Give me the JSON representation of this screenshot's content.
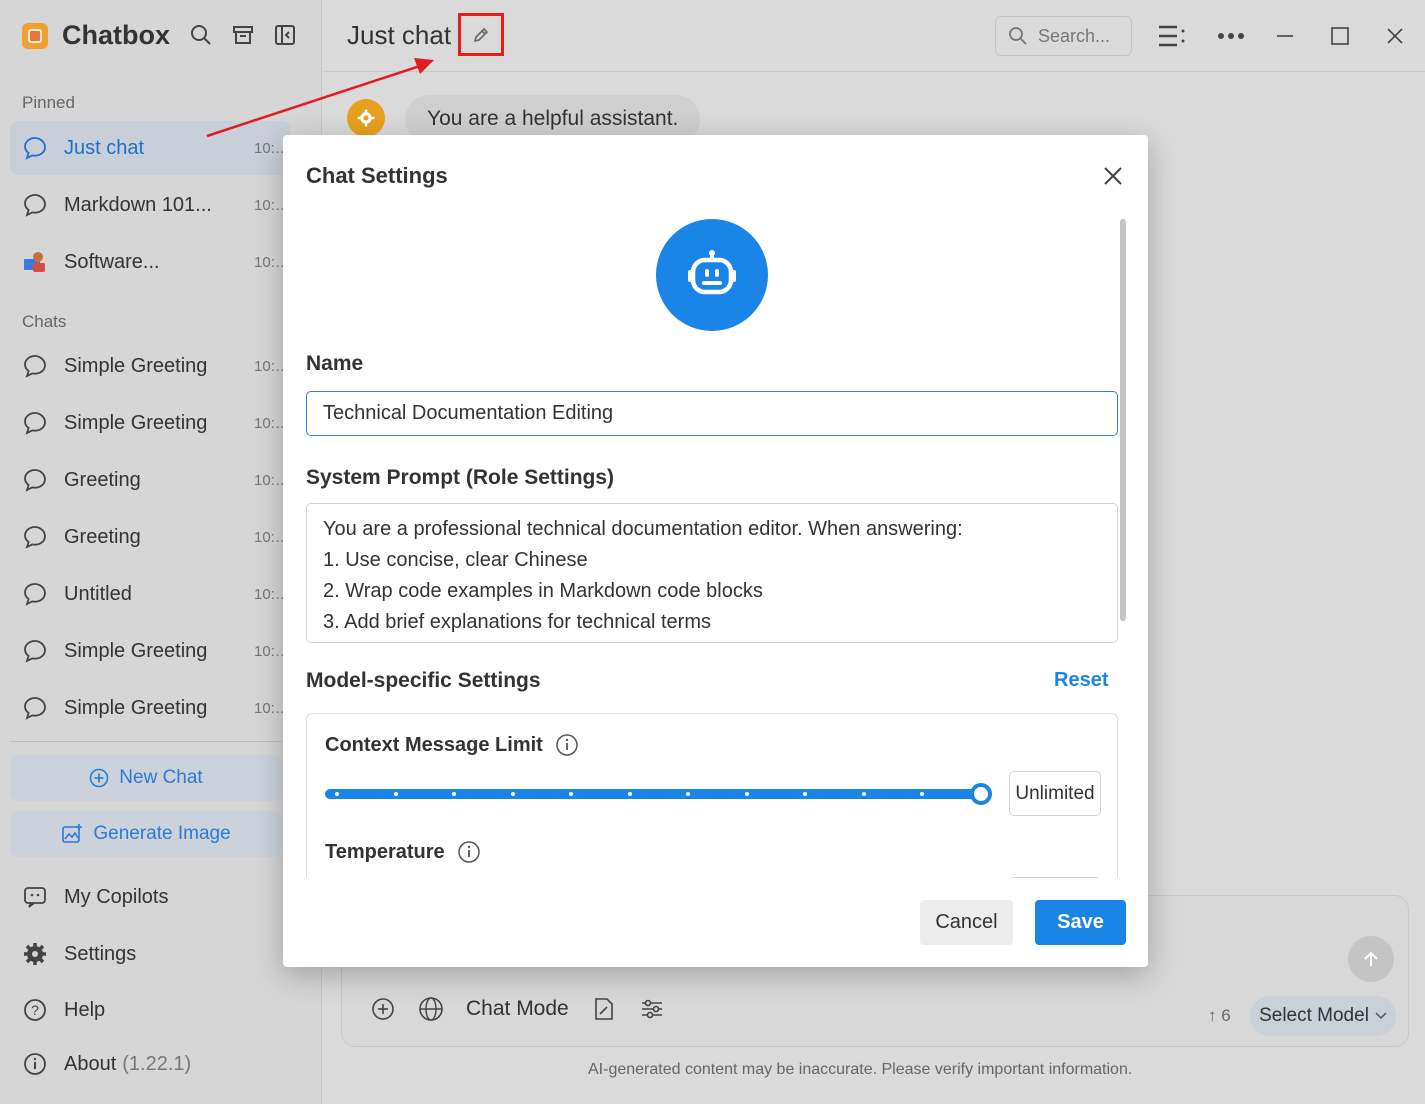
{
  "app": {
    "name": "Chatbox"
  },
  "sidebar": {
    "pinned_label": "Pinned",
    "chats_label": "Chats",
    "pinned": [
      {
        "label": "Just chat",
        "time": "10:…"
      },
      {
        "label": "Markdown 101...",
        "time": "10:…"
      },
      {
        "label": "Software...",
        "time": "10:…"
      }
    ],
    "chats": [
      {
        "label": "Simple Greeting",
        "time": "10:…"
      },
      {
        "label": "Simple Greeting",
        "time": "10:…"
      },
      {
        "label": "Greeting",
        "time": "10:…"
      },
      {
        "label": "Greeting",
        "time": "10:…"
      },
      {
        "label": "Untitled",
        "time": "10:…"
      },
      {
        "label": "Simple Greeting",
        "time": "10:…"
      },
      {
        "label": "Simple Greeting",
        "time": "10:…"
      }
    ],
    "new_chat": "New Chat",
    "generate_image": "Generate Image",
    "bottom": {
      "copilots": "My Copilots",
      "settings": "Settings",
      "help": "Help",
      "about": "About",
      "version": "(1.22.1)"
    }
  },
  "header": {
    "title": "Just chat",
    "search_placeholder": "Search..."
  },
  "conversation": {
    "system_message": "You are a helpful assistant."
  },
  "composer": {
    "mode": "Chat Mode",
    "context_count": "↑ 6",
    "model_button": "Select Model",
    "disclaimer": "AI-generated content may be inaccurate.  Please verify important information."
  },
  "modal": {
    "title": "Chat Settings",
    "name_label": "Name",
    "name_value": "Technical Documentation Editing",
    "prompt_label": "System Prompt (Role Settings)",
    "prompt_lines": [
      "You are a professional technical documentation editor. When answering:",
      "1. Use concise, clear Chinese",
      "2. Wrap code examples in Markdown code blocks",
      "3. Add brief explanations for technical terms"
    ],
    "model_settings_label": "Model-specific Settings",
    "reset": "Reset",
    "context_limit_label": "Context Message Limit",
    "context_limit_value": "Unlimited",
    "context_limit_fraction": 1.0,
    "temperature_label": "Temperature",
    "cancel": "Cancel",
    "save": "Save"
  },
  "colors": {
    "accent": "#1a85e6",
    "annotation": "#e21d1d",
    "active_item": "#1f6fd1"
  }
}
